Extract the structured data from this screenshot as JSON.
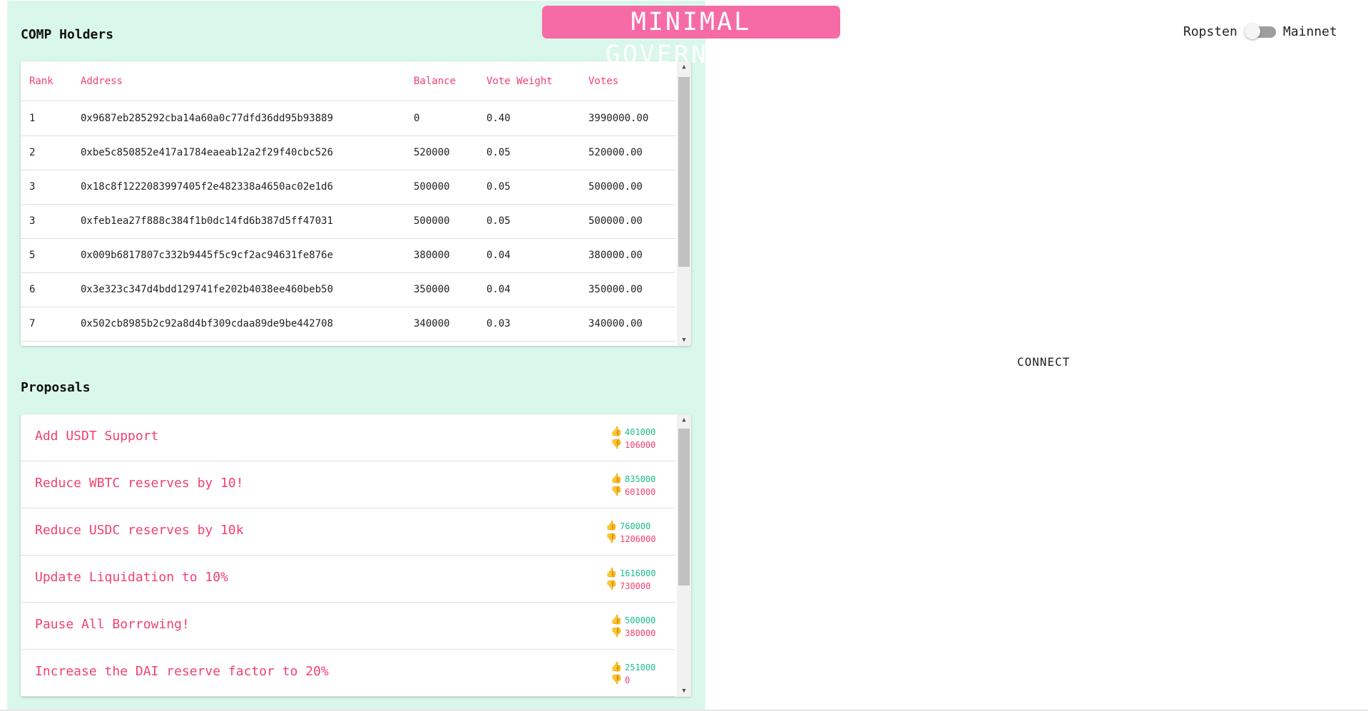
{
  "app": {
    "logo_text": "MINIMAL GOVERNANCE",
    "network_left": "Ropsten",
    "network_right": "Mainnet",
    "connect_label": "CONNECT",
    "accent_color": "#f66ba6",
    "panel_color": "#d9f7ea"
  },
  "holders": {
    "title": "COMP Holders",
    "columns": [
      "Rank",
      "Address",
      "Balance",
      "Vote Weight",
      "Votes"
    ],
    "rows": [
      {
        "rank": "1",
        "address": "0x9687eb285292cba14a60a0c77dfd36dd95b93889",
        "balance": "0",
        "vote_weight": "0.40",
        "votes": "3990000.00"
      },
      {
        "rank": "2",
        "address": "0xbe5c850852e417a1784eaeab12a2f29f40cbc526",
        "balance": "520000",
        "vote_weight": "0.05",
        "votes": "520000.00"
      },
      {
        "rank": "3",
        "address": "0x18c8f1222083997405f2e482338a4650ac02e1d6",
        "balance": "500000",
        "vote_weight": "0.05",
        "votes": "500000.00"
      },
      {
        "rank": "3",
        "address": "0xfeb1ea27f888c384f1b0dc14fd6b387d5ff47031",
        "balance": "500000",
        "vote_weight": "0.05",
        "votes": "500000.00"
      },
      {
        "rank": "5",
        "address": "0x009b6817807c332b9445f5c9cf2ac94631fe876e",
        "balance": "380000",
        "vote_weight": "0.04",
        "votes": "380000.00"
      },
      {
        "rank": "6",
        "address": "0x3e323c347d4bdd129741fe202b4038ee460beb50",
        "balance": "350000",
        "vote_weight": "0.04",
        "votes": "350000.00"
      },
      {
        "rank": "7",
        "address": "0x502cb8985b2c92a8d4bf309cdaa89de9be442708",
        "balance": "340000",
        "vote_weight": "0.03",
        "votes": "340000.00"
      }
    ]
  },
  "proposals": {
    "title": "Proposals",
    "items": [
      {
        "title": "Add USDT Support",
        "for_votes": "401000",
        "against_votes": "106000"
      },
      {
        "title": "Reduce WBTC reserves by 10!",
        "for_votes": "835000",
        "against_votes": "601000"
      },
      {
        "title": "Reduce USDC reserves by 10k",
        "for_votes": "760000",
        "against_votes": "1206000"
      },
      {
        "title": "Update Liquidation to 10%",
        "for_votes": "1616000",
        "against_votes": "730000"
      },
      {
        "title": "Pause All Borrowing!",
        "for_votes": "500000",
        "against_votes": "380000"
      },
      {
        "title": "Increase the DAI reserve factor to 20%",
        "for_votes": "251000",
        "against_votes": "0"
      }
    ]
  },
  "icons": {
    "thumbs_up": "👍",
    "thumbs_down": "👎",
    "arrow_up": "▲",
    "arrow_down": "▼"
  }
}
